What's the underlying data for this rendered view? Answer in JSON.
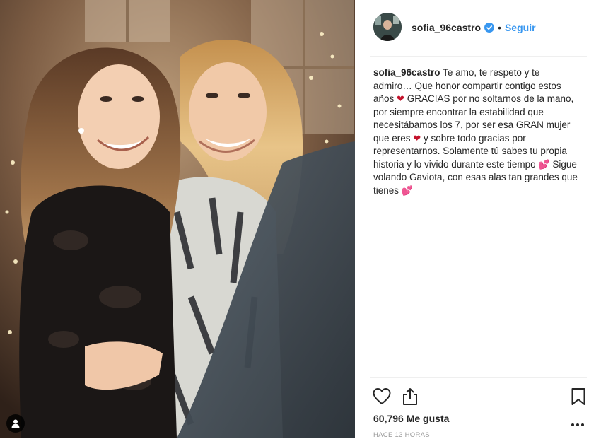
{
  "post": {
    "username": "sofia_96castro",
    "follow_label": "Seguir",
    "separator": "•",
    "caption_segments": [
      "Te amo, te respeto y te admiro… Que honor compartir contigo estos años ",
      " GRACIAS por no soltarnos de la mano, por siempre encontrar la estabilidad que necesitábamos los 7, por ser esa GRAN mujer que eres ",
      " y sobre todo gracias por representarnos. Solamente tú sabes tu propia historia y lo vivido durante este tiempo ",
      " Sigue volando Gaviota, con esas alas tan grandes que tienes "
    ],
    "caption_emojis": [
      "❤",
      "❤",
      "💕",
      "💕"
    ],
    "likes": "60,796 Me gusta",
    "timestamp": "HACE 13 HORAS"
  },
  "icons": {
    "verified": "verified-badge-icon",
    "like": "heart-icon",
    "share": "share-icon",
    "save": "bookmark-icon",
    "more": "more-options-icon",
    "tagged": "user-tag-icon"
  },
  "colors": {
    "link_blue": "#3897f0",
    "verified_blue": "#3897f0",
    "text": "#262626",
    "muted": "#999999",
    "heart_red": "#c3132c"
  }
}
